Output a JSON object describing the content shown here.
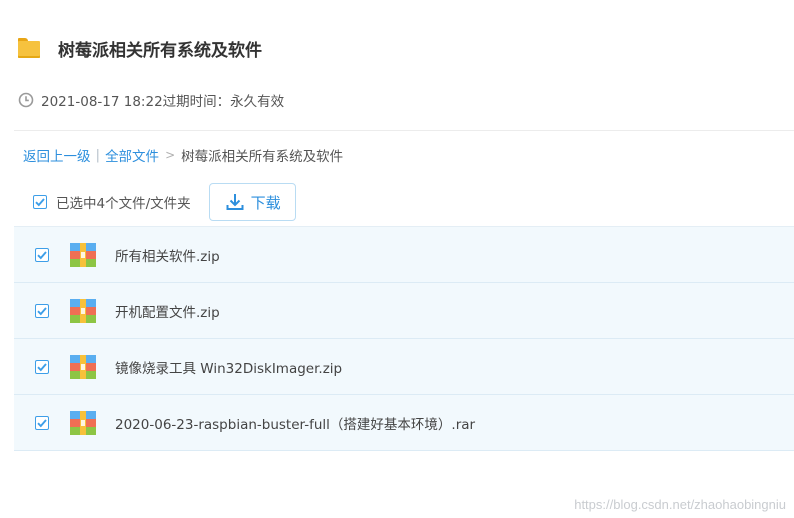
{
  "header": {
    "title": "树莓派相关所有系统及软件",
    "folder_icon": "folder-icon"
  },
  "meta": {
    "date_text": "2021-08-17 18:22过期时间：永久有效",
    "icon": "clock-icon"
  },
  "breadcrumb": {
    "back": "返回上一级",
    "separator": "|",
    "all_files": "全部文件",
    "arrow": ">",
    "current": "树莓派相关所有系统及软件"
  },
  "toolbar": {
    "selected_text": "已选中4个文件/文件夹",
    "download_label": "下载",
    "select_all_checked": true
  },
  "files": [
    {
      "name": "所有相关软件.zip",
      "checked": true
    },
    {
      "name": "开机配置文件.zip",
      "checked": true
    },
    {
      "name": "镜像烧录工具 Win32DiskImager.zip",
      "checked": true
    },
    {
      "name": "2020-06-23-raspbian-buster-full（搭建好基本环境）.rar",
      "checked": true
    }
  ],
  "watermark": "https://blog.csdn.net/zhaohaobingniu",
  "colors": {
    "link": "#2d8fdd",
    "row_bg": "#f2f9fd",
    "checkbox": "#3d9ee8",
    "folder": "#f6c23e"
  }
}
